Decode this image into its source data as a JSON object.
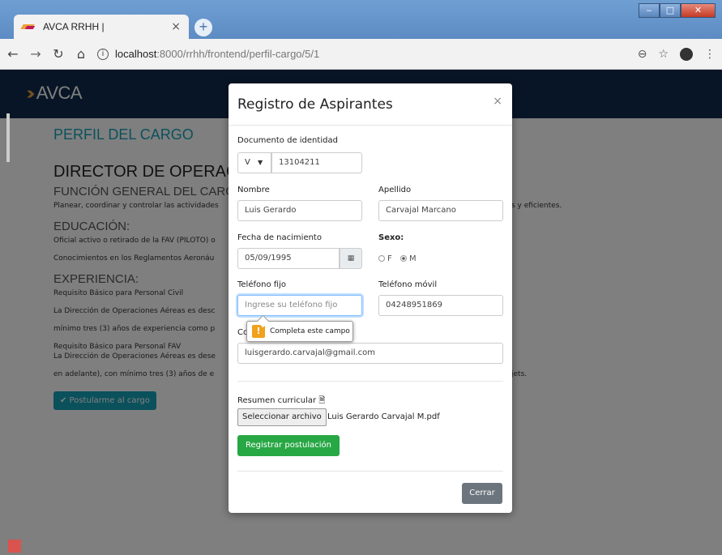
{
  "browser": {
    "tab_title": "AVCA RRHH |",
    "tab_close": "×",
    "new_tab": "+",
    "url_host": "localhost",
    "url_path": ":8000/rrhh/frontend/perfil-cargo/5/1"
  },
  "site": {
    "logo_text": "AVCA",
    "heading": "PERFIL DEL CARGO",
    "cargo": "DIRECTOR DE OPERACIO",
    "funcion_title": "FUNCIÓN GENERAL DEL CARGO",
    "funcion_text": "Planear, coordinar y controlar las actividades",
    "funcion_tail": "s y eficientes.",
    "educacion_title": "EDUCACIÓN:",
    "educacion_1": "Oficial activo o retirado de la FAV (PILOTO) o",
    "educacion_2": "Conocimientos en los Reglamentos Aeronáu",
    "experiencia_title": "EXPERIENCIA:",
    "exp_1": "Requisito Básico para Personal Civil",
    "exp_2": "La Dirección de Operaciones Aéreas es desc",
    "exp_3": "mínimo tres (3) años de experiencia como p",
    "exp_4": "Requisito Básico para Personal FAV",
    "exp_5": "La Dirección de Operaciones Aéreas es dese",
    "exp_6": "en adelante), con mínimo tres (3) años de e",
    "exp_6_tail": "jets.",
    "apply_button": "✔ Postularme al cargo"
  },
  "modal": {
    "title": "Registro de Aspirantes",
    "close": "×",
    "doc_label": "Documento de identidad",
    "doc_type": "V",
    "doc_number": "13104211",
    "nombre_label": "Nombre",
    "nombre_value": "Luis Gerardo",
    "apellido_label": "Apellido",
    "apellido_value": "Carvajal Marcano",
    "fecha_label": "Fecha de nacimiento",
    "fecha_value": "05/09/1995",
    "sexo_label": "Sexo:",
    "sexo_f": "F",
    "sexo_m": "M",
    "sexo_selected": "M",
    "tel_fijo_label": "Teléfono fijo",
    "tel_fijo_placeholder": "Ingrese su teléfono fijo",
    "tel_movil_label": "Teléfono móvil",
    "tel_movil_value": "04248951869",
    "correo_label_partial": "Co",
    "correo_value": "luisgerardo.carvajal@gmail.com",
    "tooltip_text": "Completa este campo",
    "resumen_label": "Resumen curricular",
    "file_button": "Seleccionar archivo",
    "file_name": "Luis Gerardo Carvajal M.pdf",
    "submit_button": "Registrar postulación",
    "close_button": "Cerrar"
  },
  "colors": {
    "navbar": "#102a4c",
    "accent": "#17a2b8",
    "submit": "#28a745",
    "close": "#6c757d"
  }
}
